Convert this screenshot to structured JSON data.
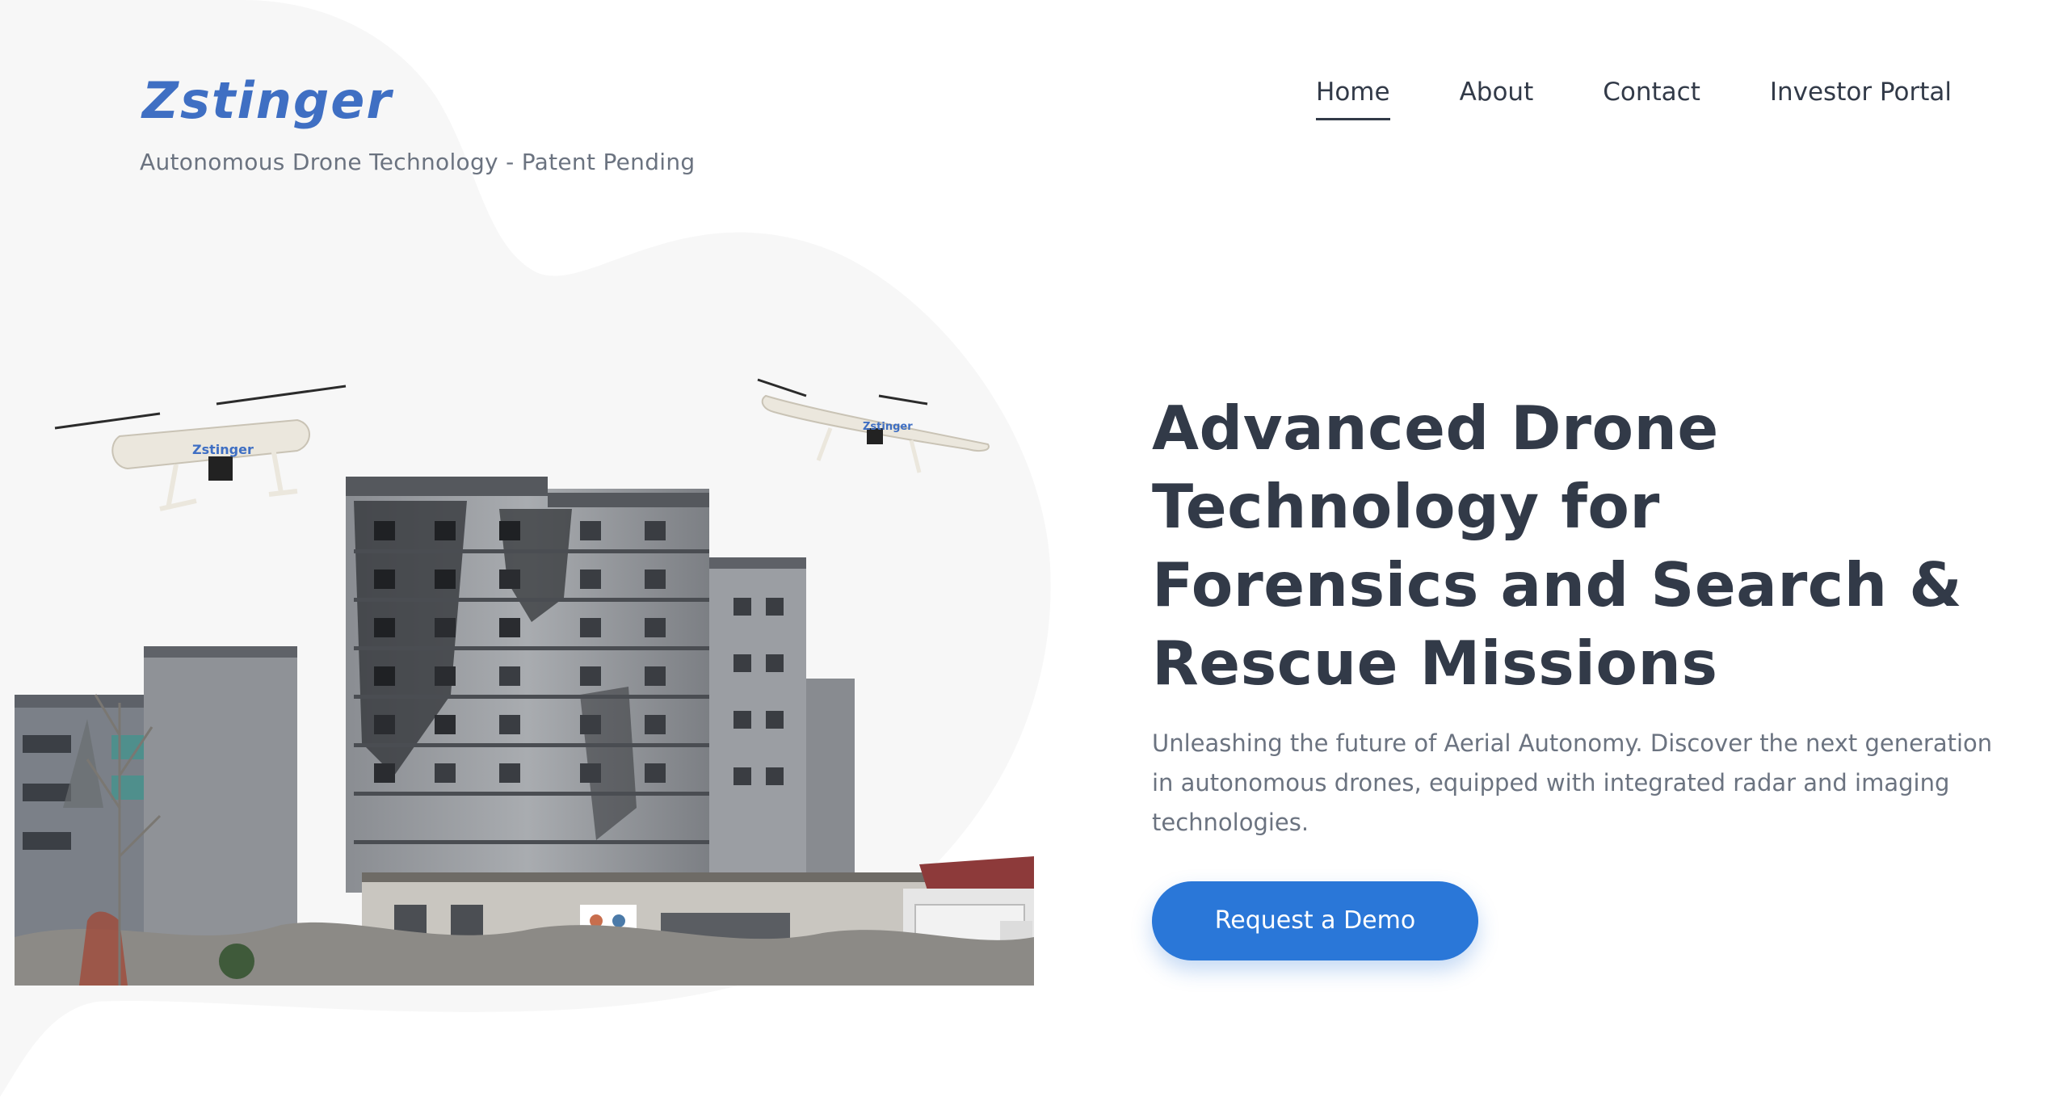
{
  "brand": {
    "logo": "Zstinger",
    "tagline": "Autonomous Drone Technology - Patent Pending"
  },
  "nav": {
    "items": [
      {
        "label": "Home",
        "active": true
      },
      {
        "label": "About",
        "active": false
      },
      {
        "label": "Contact",
        "active": false
      },
      {
        "label": "Investor Portal",
        "active": false
      }
    ]
  },
  "hero": {
    "headline": "Advanced Drone Technology for Forensics and Search & Rescue Missions",
    "subtext": "Unleashing the future of Aerial Autonomy. Discover the next generation in autonomous drones, equipped with integrated radar and imaging technologies.",
    "cta_label": "Request a Demo",
    "drone_label": "Zstinger"
  },
  "colors": {
    "brand": "#3f6fc3",
    "cta": "#2a77d8",
    "text": "#323a48",
    "muted": "#6b7380",
    "blob": "#f7f7f7"
  }
}
